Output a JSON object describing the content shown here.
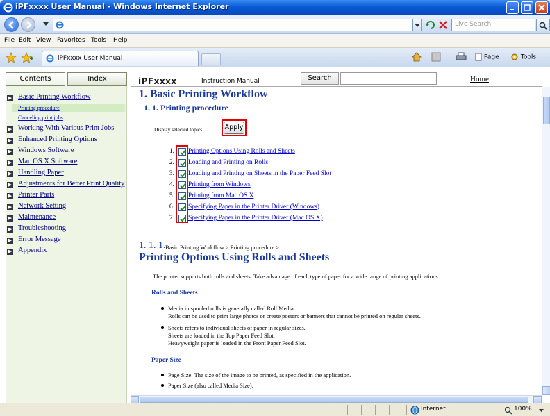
{
  "window": {
    "title": "iPFxxxx User Manual - Windows Internet Explorer"
  },
  "address": {
    "search_placeholder": "Live Search"
  },
  "menu": [
    "File",
    "Edit",
    "View",
    "Favorites",
    "Tools",
    "Help"
  ],
  "tab": {
    "label": "iPFxxxx User Manual"
  },
  "commands": {
    "page": "Page",
    "tools": "Tools"
  },
  "left": {
    "tabs": [
      "Contents",
      "Index"
    ],
    "items": [
      {
        "label": "Basic Printing Workflow"
      },
      {
        "label": "Working With Various Print Jobs"
      },
      {
        "label": "Enhanced Printing Options"
      },
      {
        "label": "Windows Software"
      },
      {
        "label": "Mac OS X Software"
      },
      {
        "label": "Handling Paper"
      },
      {
        "label": "Adjustments for Better Print Quality"
      },
      {
        "label": "Printer Parts"
      },
      {
        "label": "Network Setting"
      },
      {
        "label": "Maintenance"
      },
      {
        "label": "Troubleshooting"
      },
      {
        "label": "Error Message"
      },
      {
        "label": "Appendix"
      }
    ],
    "subitems": [
      "Printing procedure",
      "Canceling print jobs"
    ]
  },
  "header": {
    "brand": "iPFxxxx",
    "manual": "Instruction Manual",
    "search_label": "Search",
    "home": "Home"
  },
  "doc": {
    "h1": "1. Basic Printing Workflow",
    "h2": "1. 1. Printing procedure",
    "display_label": "Display selected topics.",
    "apply": "Apply",
    "topics": [
      {
        "num": "1.",
        "label": "Printing Options Using Rolls and Sheets"
      },
      {
        "num": "2.",
        "label": "Loading and Printing on Rolls"
      },
      {
        "num": "3.",
        "label": "Loading and Printing on Sheets in the Paper Feed Slot"
      },
      {
        "num": "4.",
        "label": "Printing from Windows"
      },
      {
        "num": "5.",
        "label": "Printing from Mac OS X"
      },
      {
        "num": "6.",
        "label": "Specifying Paper in the Printer Driver (Windows)"
      },
      {
        "num": "7.",
        "label": "Specifying Paper in the Printer Driver (Mac OS X)"
      }
    ],
    "crumb_num": "1. 1. 1.",
    "crumb_text": "Basic Printing Workflow > Printing procedure >",
    "section_title": "Printing Options Using Rolls and Sheets",
    "intro": "The printer supports both rolls and sheets. Take advantage of each type of paper for a wide range of printing applications.",
    "rolls_head": "Rolls and Sheets",
    "rolls_b1": "Media in spooled rolls is generally called Roll Media.",
    "rolls_b1_cont": "Rolls can be used to print large photos or create posters or banners that cannot be printed on regular sheets.",
    "rolls_b2": "Sheets refers to individual sheets of paper in regular sizes.",
    "rolls_b2_cont1": "Sheets are loaded in the Top Paper Feed Slot.",
    "rolls_b2_cont2": "Heavyweight paper is loaded in the Front Paper Feed Slot.",
    "size_head": "Paper Size",
    "size_b1": "Page Size: The size of the image to be printed, as specified in the application.",
    "size_b2": "Paper Size (also called Media Size):"
  },
  "status": {
    "zone": "Internet",
    "zoom": "100%"
  }
}
